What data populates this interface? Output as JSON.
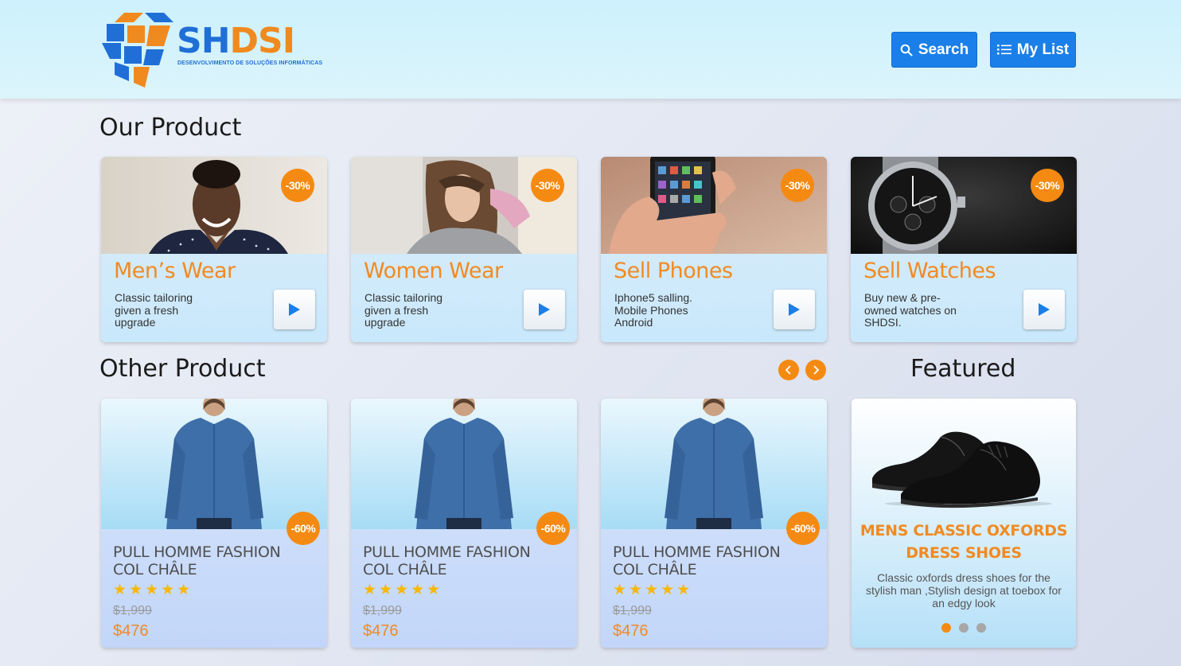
{
  "brand": {
    "name_part1": "SH",
    "name_part2": "DSI",
    "tagline": "DESENVOLVIMENTO DE SOLUÇÕES INFORMÁTICAS",
    "primary_color": "#1f6fd6",
    "accent_color": "#f08a1e"
  },
  "header": {
    "search_label": "Search",
    "mylist_label": "My List"
  },
  "our_product": {
    "heading": "Our Product",
    "cards": [
      {
        "title": "Men’s Wear",
        "badge": "-30%",
        "desc": "Classic tailoring given a fresh upgrade"
      },
      {
        "title": "Women Wear",
        "badge": "-30%",
        "desc": "Classic tailoring given a fresh upgrade"
      },
      {
        "title": "Sell Phones",
        "badge": "-30%",
        "desc": "Iphone5 salling. Mobile Phones Android"
      },
      {
        "title": "Sell Watches",
        "badge": "-30%",
        "desc": "Buy new & pre-owned watches on SHDSI."
      }
    ]
  },
  "other_product": {
    "heading": "Other Product",
    "items": [
      {
        "name": "PULL HOMME FASHION COL CHÂLE",
        "badge": "-60%",
        "stars": "★★★★★",
        "old_price": "$1,999",
        "price": "$476",
        "rating": 5
      },
      {
        "name": "PULL HOMME FASHION COL CHÂLE",
        "badge": "-60%",
        "stars": "★★★★★",
        "old_price": "$1,999",
        "price": "$476",
        "rating": 5
      },
      {
        "name": "PULL HOMME FASHION COL CHÂLE",
        "badge": "-60%",
        "stars": "★★★★★",
        "old_price": "$1,999",
        "price": "$476",
        "rating": 5
      }
    ]
  },
  "featured": {
    "heading": "Featured",
    "title": "MENS CLASSIC OXFORDS DRESS SHOES",
    "desc": "Classic oxfords dress shoes for the stylish man ,Stylish design at toebox for an edgy look",
    "active_slide": 1,
    "slide_count": 3
  }
}
